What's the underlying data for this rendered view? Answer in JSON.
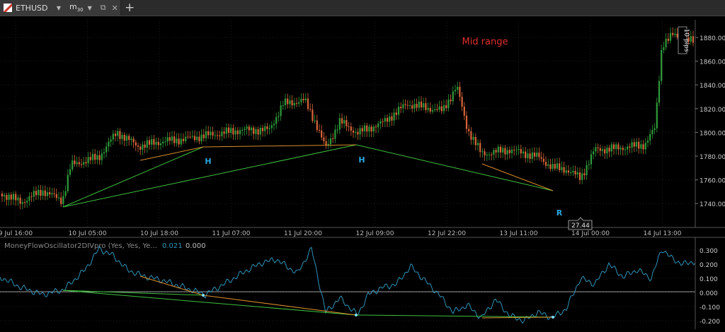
{
  "toolbar": {
    "symbol": "ETHUSD",
    "period_letter": "m",
    "period_value": "30",
    "dropdown_glyph": "▼",
    "detach_glyph": "⧉",
    "close_glyph": "✕",
    "add_glyph": "+"
  },
  "main_chart": {
    "annotation_mid_range": "Mid range",
    "labels": {
      "h1": "H",
      "h2": "H",
      "r": "R"
    },
    "spread_label": "10 pips",
    "crosshair_value": "27.44",
    "y_ticks": [
      "1880.00",
      "1860.00",
      "1840.00",
      "1820.00",
      "1800.00",
      "1780.00",
      "1760.00",
      "1740.00"
    ],
    "x_ticks": [
      "9 Jul 16:00",
      "10 Jul 05:00",
      "10 Jul 18:00",
      "11 Jul 07:00",
      "11 Jul 20:00",
      "12 Jul 09:00",
      "12 Jul 22:00",
      "13 Jul 11:00",
      "14 Jul 00:00",
      "14 Jul 13:00"
    ],
    "colors": {
      "bull": "#2e9a3a",
      "bear": "#d8653a",
      "green_line": "#3ec03e",
      "orange_line": "#d98c2a",
      "h_label": "#2aa8e0",
      "r_label": "#2aa8e0",
      "mid_range": "#e03030"
    }
  },
  "indicator": {
    "title": "MoneyFlowOscillator2DIVpro (Yes, Yes, Ye...",
    "value1": "0.021",
    "value2": "0.000",
    "y_ticks": [
      "0.300",
      "0.200",
      "0.100",
      "0.000",
      "-0.100",
      "-0.200"
    ],
    "colors": {
      "line": "#2f93b8",
      "value1": "#2f93b8",
      "zero_line": "#cfcfcf"
    }
  }
}
